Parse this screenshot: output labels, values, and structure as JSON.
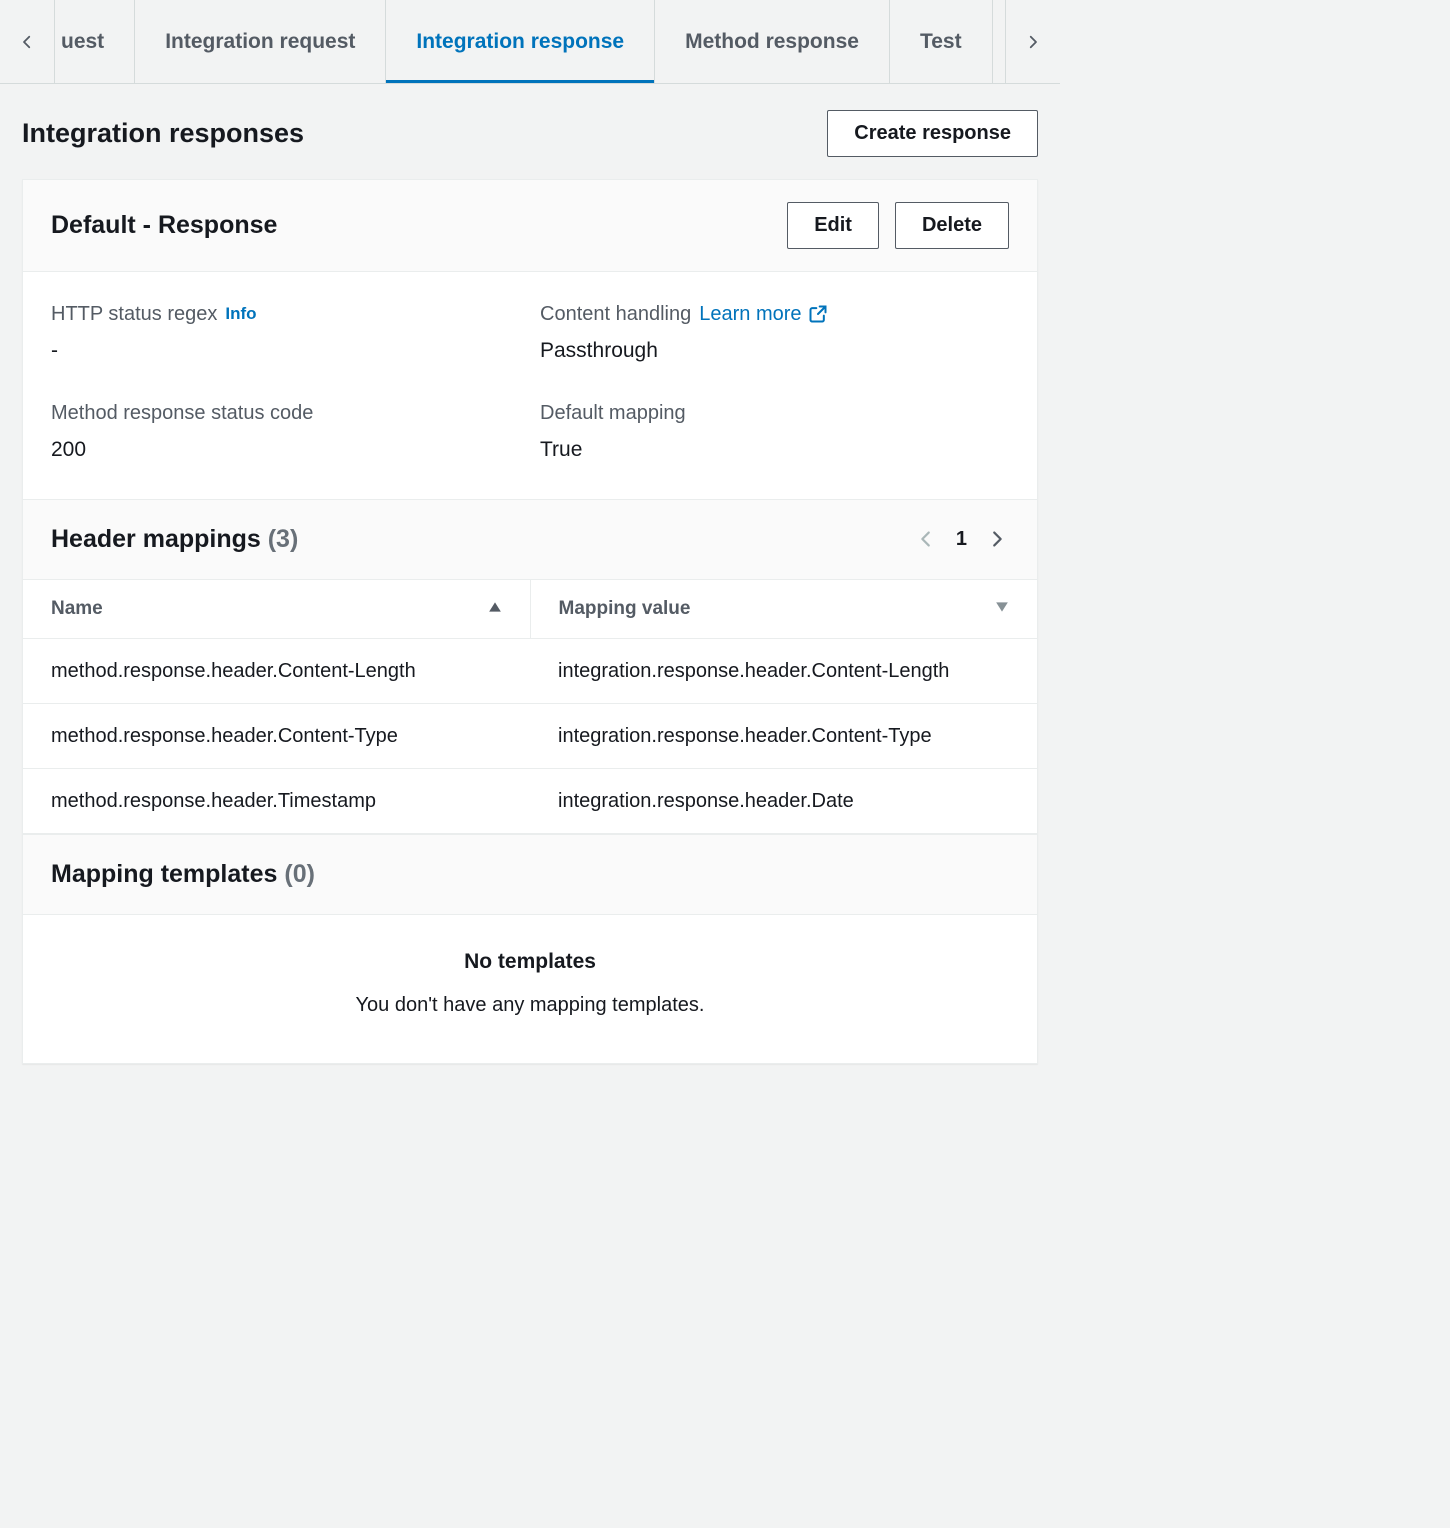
{
  "tabs": {
    "partial_left": "uest",
    "items": [
      {
        "label": "Integration request",
        "active": false
      },
      {
        "label": "Integration response",
        "active": true
      },
      {
        "label": "Method response",
        "active": false
      },
      {
        "label": "Test",
        "active": false
      }
    ]
  },
  "page": {
    "title": "Integration responses",
    "create_button": "Create response"
  },
  "response_card": {
    "title": "Default - Response",
    "edit_button": "Edit",
    "delete_button": "Delete",
    "fields": {
      "http_status_regex": {
        "label": "HTTP status regex",
        "info": "Info",
        "value": "-"
      },
      "content_handling": {
        "label": "Content handling",
        "learn_more": "Learn more",
        "value": "Passthrough"
      },
      "method_response_status_code": {
        "label": "Method response status code",
        "value": "200"
      },
      "default_mapping": {
        "label": "Default mapping",
        "value": "True"
      }
    }
  },
  "header_mappings": {
    "title": "Header mappings",
    "count_display": "(3)",
    "pager": {
      "current": "1"
    },
    "columns": {
      "name": "Name",
      "mapping_value": "Mapping value"
    },
    "rows": [
      {
        "name": "method.response.header.Content-Length",
        "mapping_value": "integration.response.header.Content-Length"
      },
      {
        "name": "method.response.header.Content-Type",
        "mapping_value": "integration.response.header.Content-Type"
      },
      {
        "name": "method.response.header.Timestamp",
        "mapping_value": "integration.response.header.Date"
      }
    ]
  },
  "mapping_templates": {
    "title": "Mapping templates",
    "count_display": "(0)",
    "empty_title": "No templates",
    "empty_sub": "You don't have any mapping templates."
  }
}
